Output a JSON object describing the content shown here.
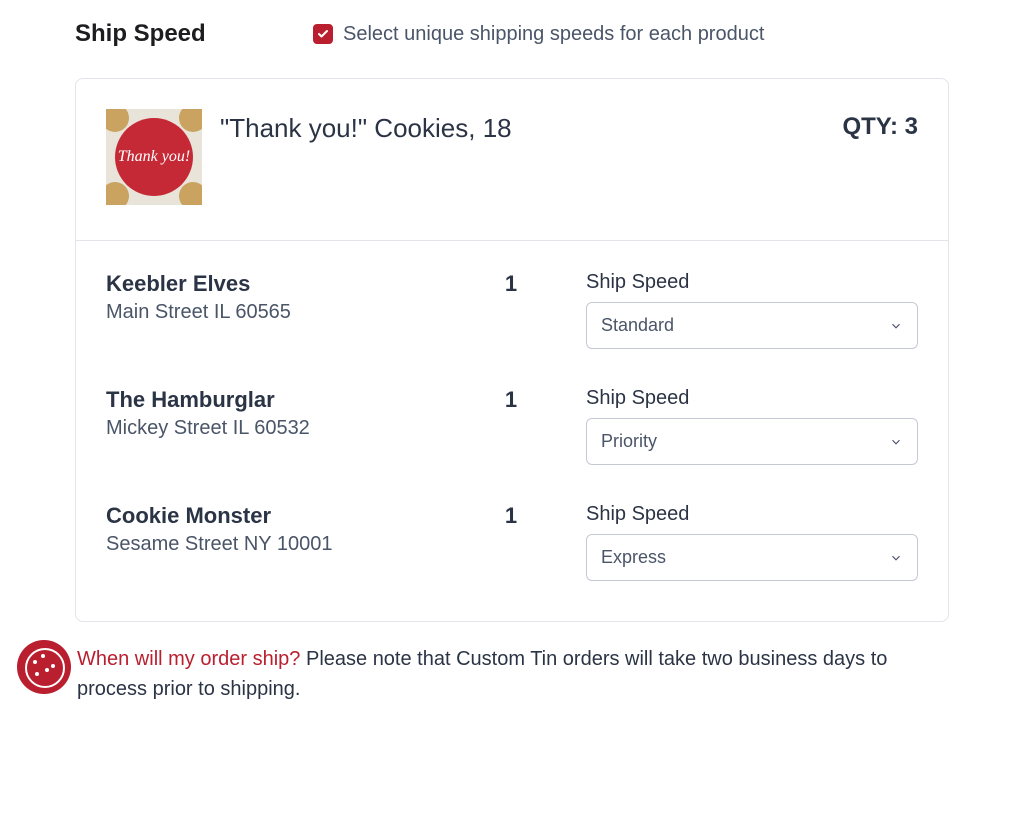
{
  "header": {
    "title": "Ship Speed",
    "checkbox_label": "Select unique shipping speeds for each product",
    "checkbox_checked": true
  },
  "product": {
    "name": "\"Thank you!\" Cookies, 18",
    "qty_label": "QTY: 3",
    "image_badge_text": "Thank you!"
  },
  "recipients": [
    {
      "name": "Keebler Elves",
      "address": "Main Street IL 60565",
      "qty": "1",
      "speed_label": "Ship Speed",
      "speed_value": "Standard"
    },
    {
      "name": "The Hamburglar",
      "address": "Mickey Street IL 60532",
      "qty": "1",
      "speed_label": "Ship Speed",
      "speed_value": "Priority"
    },
    {
      "name": "Cookie Monster",
      "address": "Sesame Street NY 10001",
      "qty": "1",
      "speed_label": "Ship Speed",
      "speed_value": "Express"
    }
  ],
  "footer": {
    "link_text": "When will my order ship?",
    "note_text": " Please note that Custom Tin orders will take two business days to process prior to shipping."
  }
}
